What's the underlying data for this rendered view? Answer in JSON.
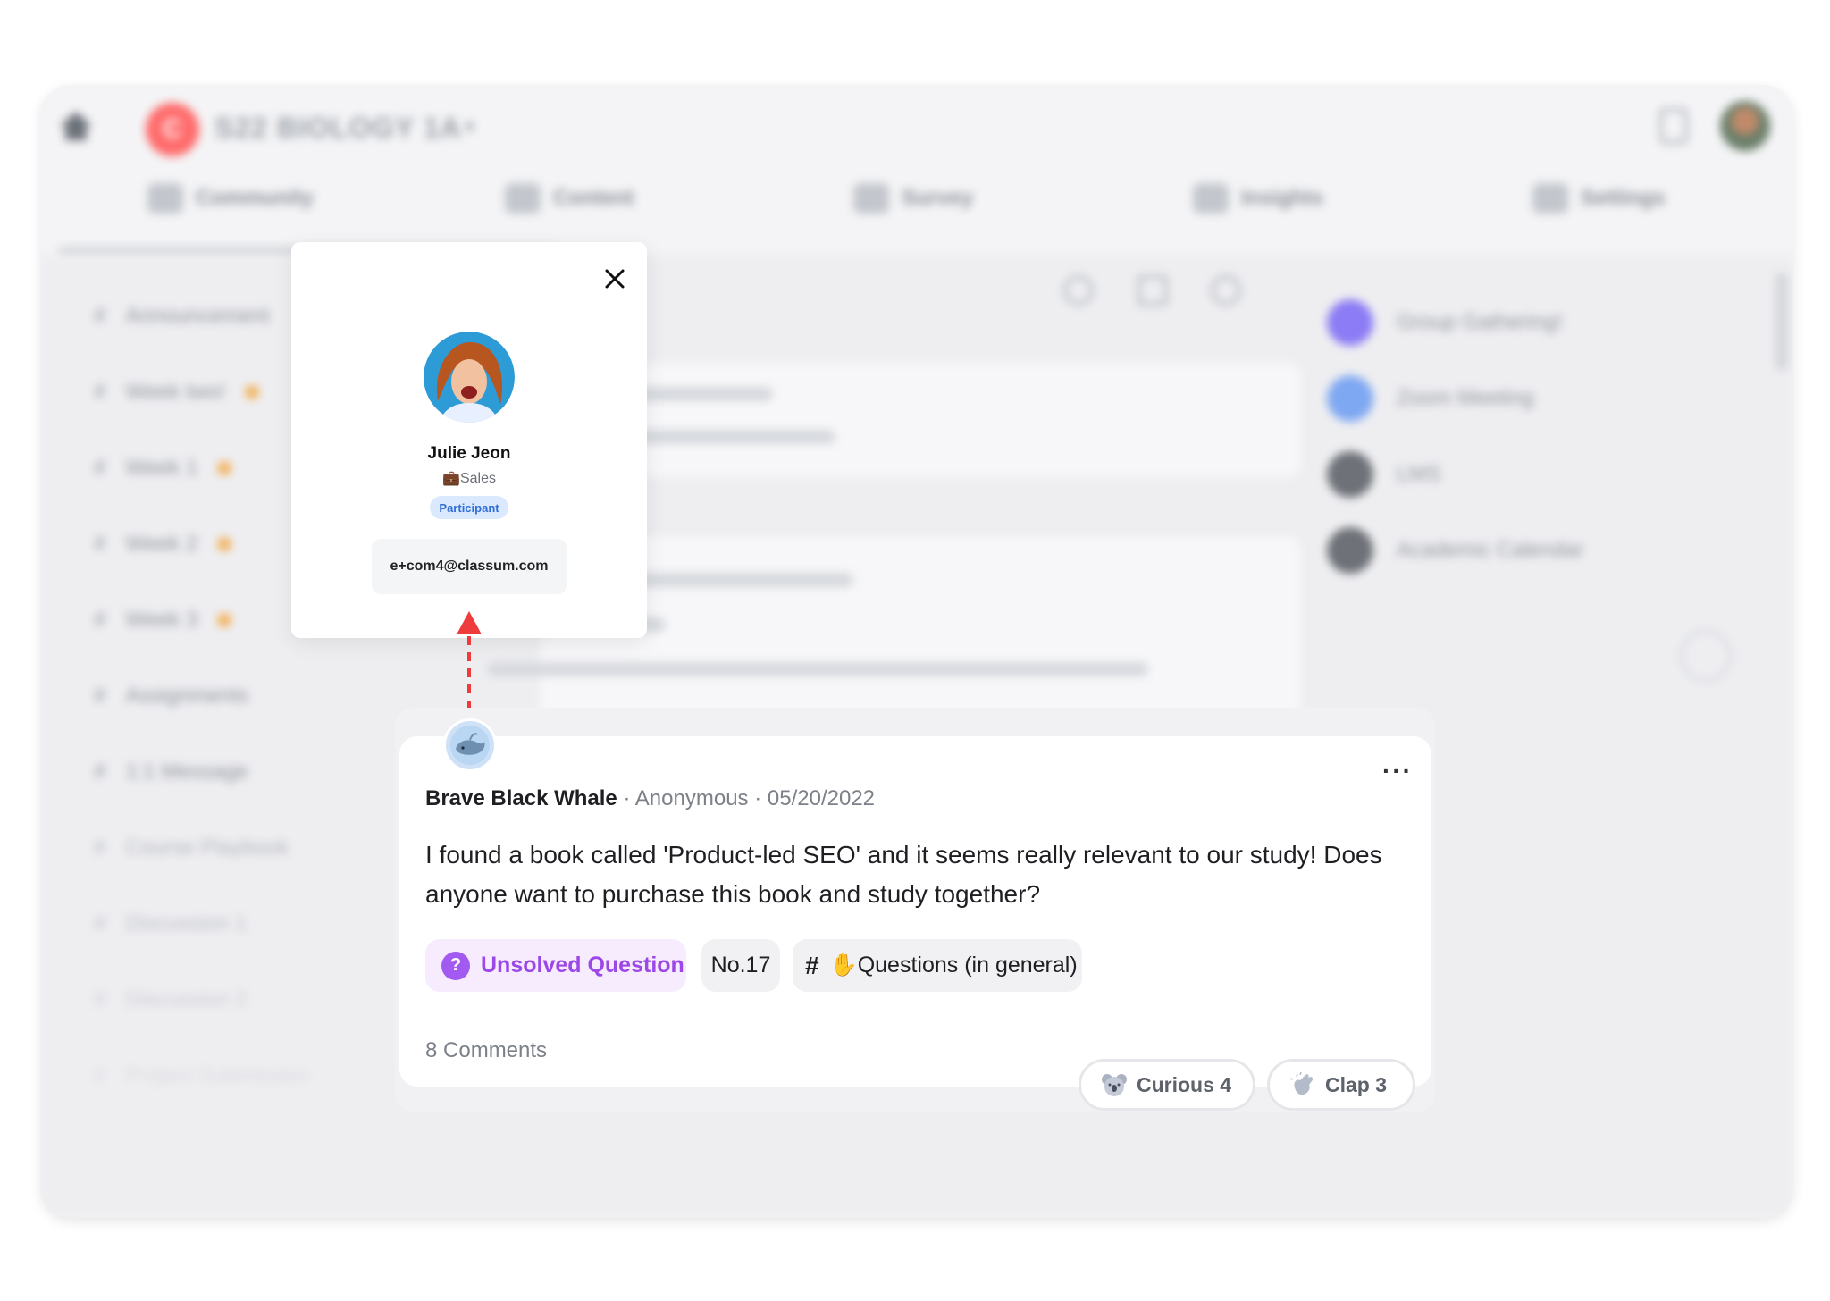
{
  "app": {
    "course_logo_letter": "C",
    "course_name": "S22 BIOLOGY 1A",
    "tabs": [
      {
        "label": "Community"
      },
      {
        "label": "Content"
      },
      {
        "label": "Survey"
      },
      {
        "label": "Insights"
      },
      {
        "label": "Settings"
      }
    ],
    "sidebar": [
      {
        "label": "Announcement"
      },
      {
        "label": "Week two!"
      },
      {
        "label": "Week 1"
      },
      {
        "label": "Week 2"
      },
      {
        "label": "Week 3"
      },
      {
        "label": "Assignments"
      },
      {
        "label": "1:1 Message"
      },
      {
        "label": "Course Playbook"
      },
      {
        "label": "Discussion 1"
      },
      {
        "label": "Discussion 2"
      },
      {
        "label": "Project Submission"
      }
    ],
    "right_panel": [
      {
        "label": "Group Gathering!"
      },
      {
        "label": "Zoom Meeting"
      },
      {
        "label": "LMS"
      },
      {
        "label": "Academic Calendar"
      }
    ]
  },
  "profile_popup": {
    "name": "Julie Jeon",
    "role": "💼Sales",
    "badge": "Participant",
    "email": "e+com4@classum.com"
  },
  "post": {
    "author": "Brave Black Whale",
    "visibility": "Anonymous",
    "date": "05/20/2022",
    "body": "I found a book called 'Product-led SEO' and it seems really relevant to our study! Does anyone want to purchase this book and study together?",
    "status_tag": "Unsolved Question",
    "number_tag": "No.17",
    "topic_tag": "✋Questions (in general)",
    "comments": "8 Comments",
    "reactions": [
      {
        "label": "Curious 4",
        "icon": "koala-icon"
      },
      {
        "label": "Clap 3",
        "icon": "clap-icon"
      }
    ]
  },
  "colors": {
    "accent_purple": "#9c48e8",
    "badge_blue": "#2f6fd6",
    "annotation_red": "#ee3b3b"
  }
}
